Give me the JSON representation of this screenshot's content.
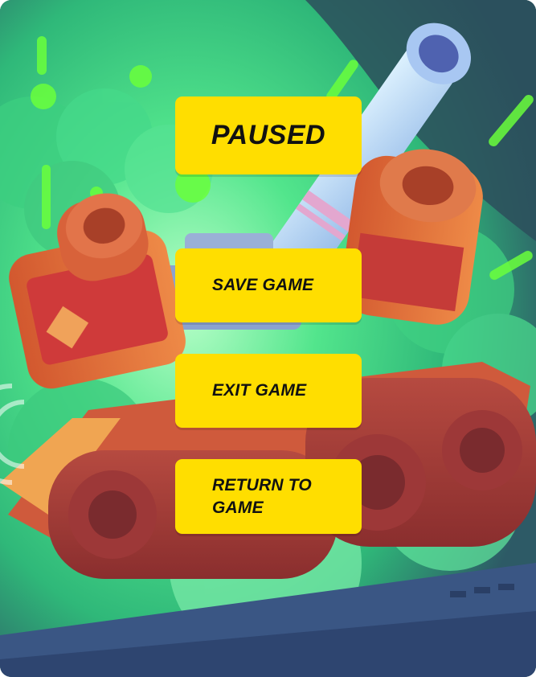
{
  "menu": {
    "title": "PAUSED",
    "buttons": {
      "save": "SAVE GAME",
      "exit": "EXIT GAME",
      "return": "RETURN TO GAME"
    }
  },
  "colors": {
    "button_yellow": "#ffde00",
    "text_black": "#111111",
    "background_green": "#45e08a",
    "background_teal": "#2f5a66",
    "ground_blue": "#3a5684",
    "tank_red": "#b8443a"
  },
  "background": {
    "scene": "tank-illustration"
  }
}
